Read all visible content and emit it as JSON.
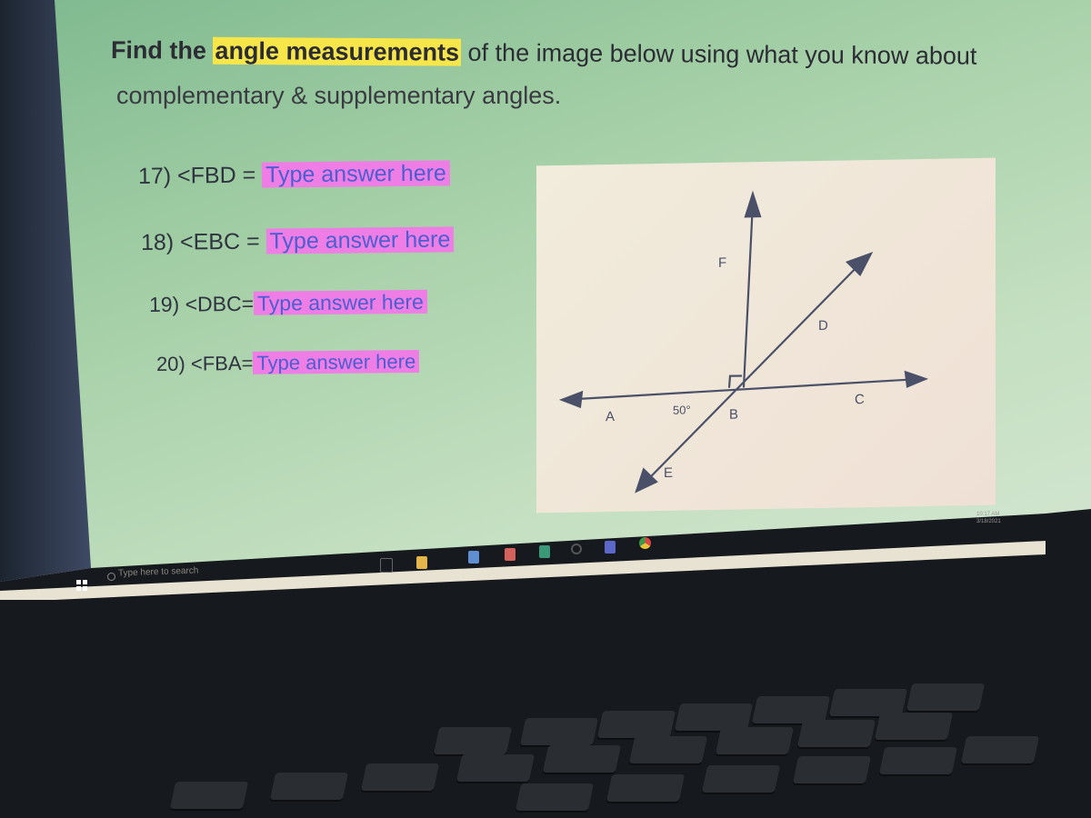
{
  "worksheet": {
    "title_prefix": "Find the ",
    "title_highlight": "angle measurements",
    "title_suffix": " of the image below using what you know about",
    "title_line2": "complementary & supplementary angles.",
    "questions": [
      {
        "label": "17) <FBD = ",
        "answer": "Type answer here"
      },
      {
        "label": "18) <EBC = ",
        "answer": "Type answer here"
      },
      {
        "label": "19) <DBC=",
        "answer": "Type answer here"
      },
      {
        "label": "20) <FBA=",
        "answer": "Type answer here"
      }
    ],
    "highlight_color": "#f7e64a",
    "answer_box_color": "#ee7de6"
  },
  "diagram": {
    "labels": {
      "A": "A",
      "B": "B",
      "C": "C",
      "D": "D",
      "E": "E",
      "F": "F"
    },
    "angle_label": "50°"
  },
  "taskbar": {
    "search_placeholder": "Type here to search",
    "icons": [
      "task-view-icon",
      "file-explorer-icon",
      "calendar-icon",
      "app-icon",
      "app-icon",
      "settings-icon",
      "teams-icon",
      "chrome-icon"
    ],
    "clock_time": "10:17 AM",
    "clock_date": "3/18/2021"
  }
}
